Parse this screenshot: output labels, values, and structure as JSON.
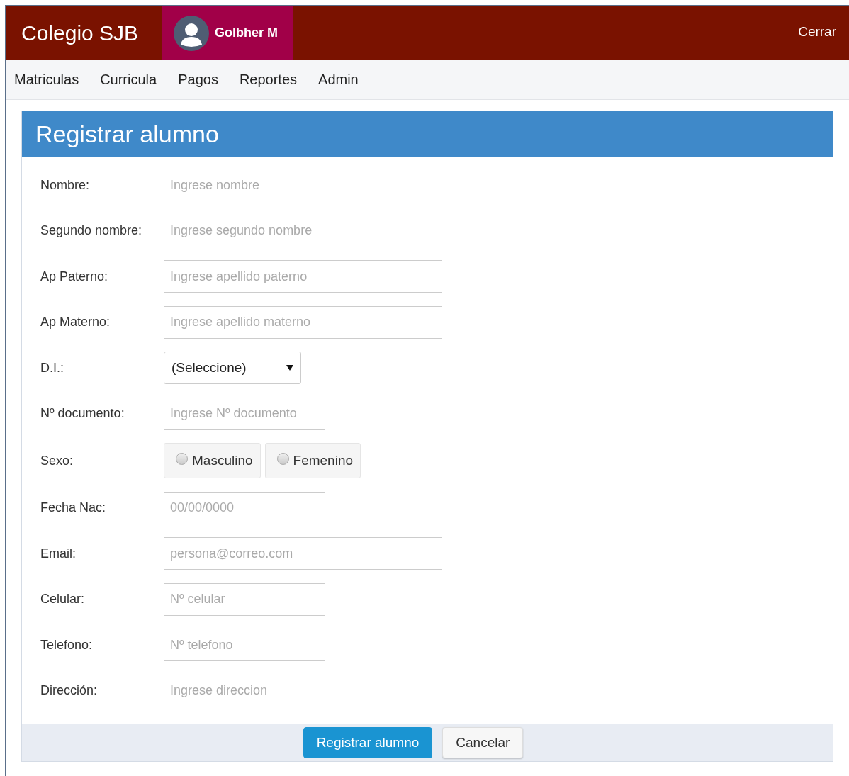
{
  "header": {
    "brand": "Colegio SJB",
    "user": "Golbher M",
    "logout": "Cerrar"
  },
  "nav": [
    "Matriculas",
    "Curricula",
    "Pagos",
    "Reportes",
    "Admin"
  ],
  "form": {
    "title": "Registrar alumno",
    "fields": [
      {
        "label": "Nombre:",
        "kind": "text",
        "placeholder": "Ingrese nombre"
      },
      {
        "label": "Segundo nombre:",
        "kind": "text",
        "placeholder": "Ingrese segundo nombre"
      },
      {
        "label": "Ap Paterno:",
        "kind": "text",
        "placeholder": "Ingrese apellido paterno"
      },
      {
        "label": "Ap Materno:",
        "kind": "text",
        "placeholder": "Ingrese apellido materno"
      },
      {
        "label": "D.I.:",
        "kind": "select",
        "value": "(Seleccione)"
      },
      {
        "label": "Nº documento:",
        "kind": "short",
        "placeholder": "Ingrese Nº documento"
      },
      {
        "label": "Sexo:",
        "kind": "radio",
        "options": [
          {
            "label": "Masculino",
            "selected": false
          },
          {
            "label": "Femenino",
            "selected": false
          }
        ]
      },
      {
        "label": "Fecha Nac:",
        "kind": "short",
        "placeholder": "00/00/0000"
      },
      {
        "label": "Email:",
        "kind": "text",
        "placeholder": "persona@correo.com"
      },
      {
        "label": "Celular:",
        "kind": "short",
        "placeholder": "Nº celular"
      },
      {
        "label": "Telefono:",
        "kind": "short",
        "placeholder": "Nº telefono"
      },
      {
        "label": "Dirección:",
        "kind": "text",
        "placeholder": "Ingrese direccion"
      }
    ],
    "buttons": [
      {
        "label": "Registrar alumno",
        "kind": "primary"
      },
      {
        "label": "Cancelar",
        "kind": "secondary"
      }
    ]
  }
}
